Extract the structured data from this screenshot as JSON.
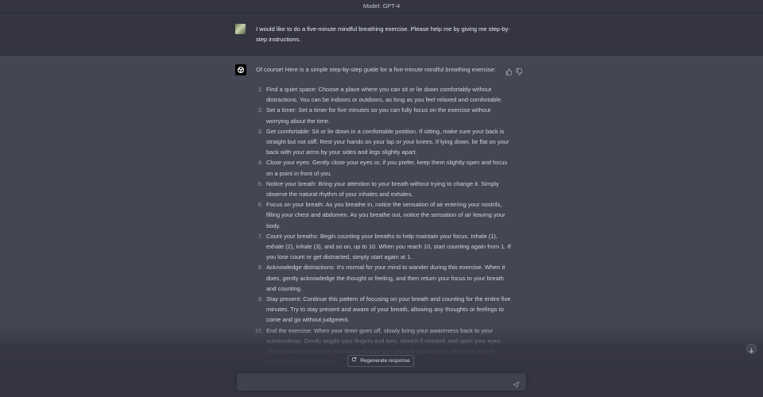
{
  "header": {
    "model_label": "Model: GPT-4"
  },
  "user_message": {
    "text": "I would like to do a five-minute mindful breathing exercise. Please help me by giving me step-by-step instructions."
  },
  "assistant_message": {
    "intro": "Of course! Here is a simple step-by-step guide for a five-minute mindful breathing exercise:",
    "steps": [
      {
        "num": "1.",
        "text": "Find a quiet space: Choose a place where you can sit or lie down comfortably without distractions. You can be indoors or outdoors, as long as you feel relaxed and comfortable."
      },
      {
        "num": "2.",
        "text": "Set a timer: Set a timer for five minutes so you can fully focus on the exercise without worrying about the time."
      },
      {
        "num": "3.",
        "text": "Get comfortable: Sit or lie down in a comfortable position. If sitting, make sure your back is straight but not stiff. Rest your hands on your lap or your knees. If lying down, lie flat on your back with your arms by your sides and legs slightly apart."
      },
      {
        "num": "4.",
        "text": "Close your eyes: Gently close your eyes or, if you prefer, keep them slightly open and focus on a point in front of you."
      },
      {
        "num": "5.",
        "text": "Notice your breath: Bring your attention to your breath without trying to change it. Simply observe the natural rhythm of your inhales and exhales."
      },
      {
        "num": "6.",
        "text": "Focus on your breath: As you breathe in, notice the sensation of air entering your nostrils, filling your chest and abdomen. As you breathe out, notice the sensation of air leaving your body."
      },
      {
        "num": "7.",
        "text": "Count your breaths: Begin counting your breaths to help maintain your focus. Inhale (1), exhale (2), inhale (3), and so on, up to 10. When you reach 10, start counting again from 1. If you lose count or get distracted, simply start again at 1."
      },
      {
        "num": "8.",
        "text": "Acknowledge distractions: It's normal for your mind to wander during this exercise. When it does, gently acknowledge the thought or feeling, and then return your focus to your breath and counting."
      },
      {
        "num": "9.",
        "text": "Stay present: Continue this pattern of focusing on your breath and counting for the entire five minutes. Try to stay present and aware of your breath, allowing any thoughts or feelings to come and go without judgment."
      },
      {
        "num": "10.",
        "text": "End the exercise: When your timer goes off, slowly bring your awareness back to your surroundings. Gently wiggle your fingers and toes, stretch if needed, and open your eyes. Take a moment to notice how you feel, and give yourself gratitude for taking the time to practice mindful breathing."
      }
    ]
  },
  "controls": {
    "regenerate_label": "Regenerate response",
    "input_placeholder": "",
    "icons": [
      "thumbs-up-icon",
      "thumbs-down-icon",
      "refresh-icon",
      "send-icon",
      "arrow-down-icon",
      "openai-logo-icon"
    ]
  },
  "colors": {
    "page_bg": "#343541",
    "assistant_bg": "#444654",
    "input_bg": "#40414f",
    "text": "#d1d5db"
  }
}
